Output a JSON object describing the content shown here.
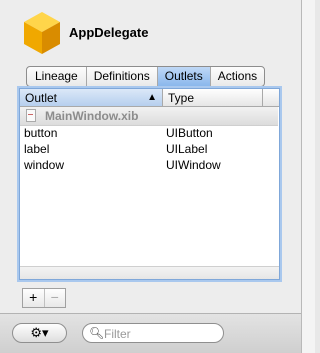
{
  "header": {
    "title": "AppDelegate",
    "icon": "object-cube-icon",
    "accent": "#f2b400"
  },
  "tabs": [
    {
      "label": "Lineage"
    },
    {
      "label": "Definitions"
    },
    {
      "label": "Outlets",
      "selected": true
    },
    {
      "label": "Actions"
    }
  ],
  "table": {
    "columns": [
      "Outlet",
      "Type"
    ],
    "group": "MainWindow.xib",
    "rows": [
      {
        "outlet": "button",
        "type": "UIButton"
      },
      {
        "outlet": "label",
        "type": "UILabel"
      },
      {
        "outlet": "window",
        "type": "UIWindow"
      }
    ]
  },
  "buttons": {
    "add": "+",
    "remove": "−"
  },
  "footer": {
    "gear": "⚙▾",
    "search_placeholder": "Filter"
  }
}
